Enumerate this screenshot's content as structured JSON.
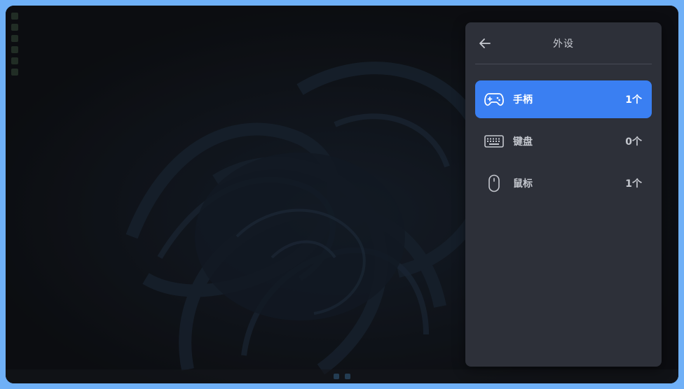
{
  "panel": {
    "title": "外设",
    "back_icon": "arrow-left-icon"
  },
  "devices": [
    {
      "label": "手柄",
      "count": "1个",
      "icon": "gamepad-icon",
      "selected": true
    },
    {
      "label": "键盘",
      "count": "0个",
      "icon": "keyboard-icon",
      "selected": false
    },
    {
      "label": "鼠标",
      "count": "1个",
      "icon": "mouse-icon",
      "selected": false
    }
  ],
  "colors": {
    "accent": "#3a7ff2",
    "panel_bg": "#2d3039",
    "frame": "#6fb0f7"
  }
}
